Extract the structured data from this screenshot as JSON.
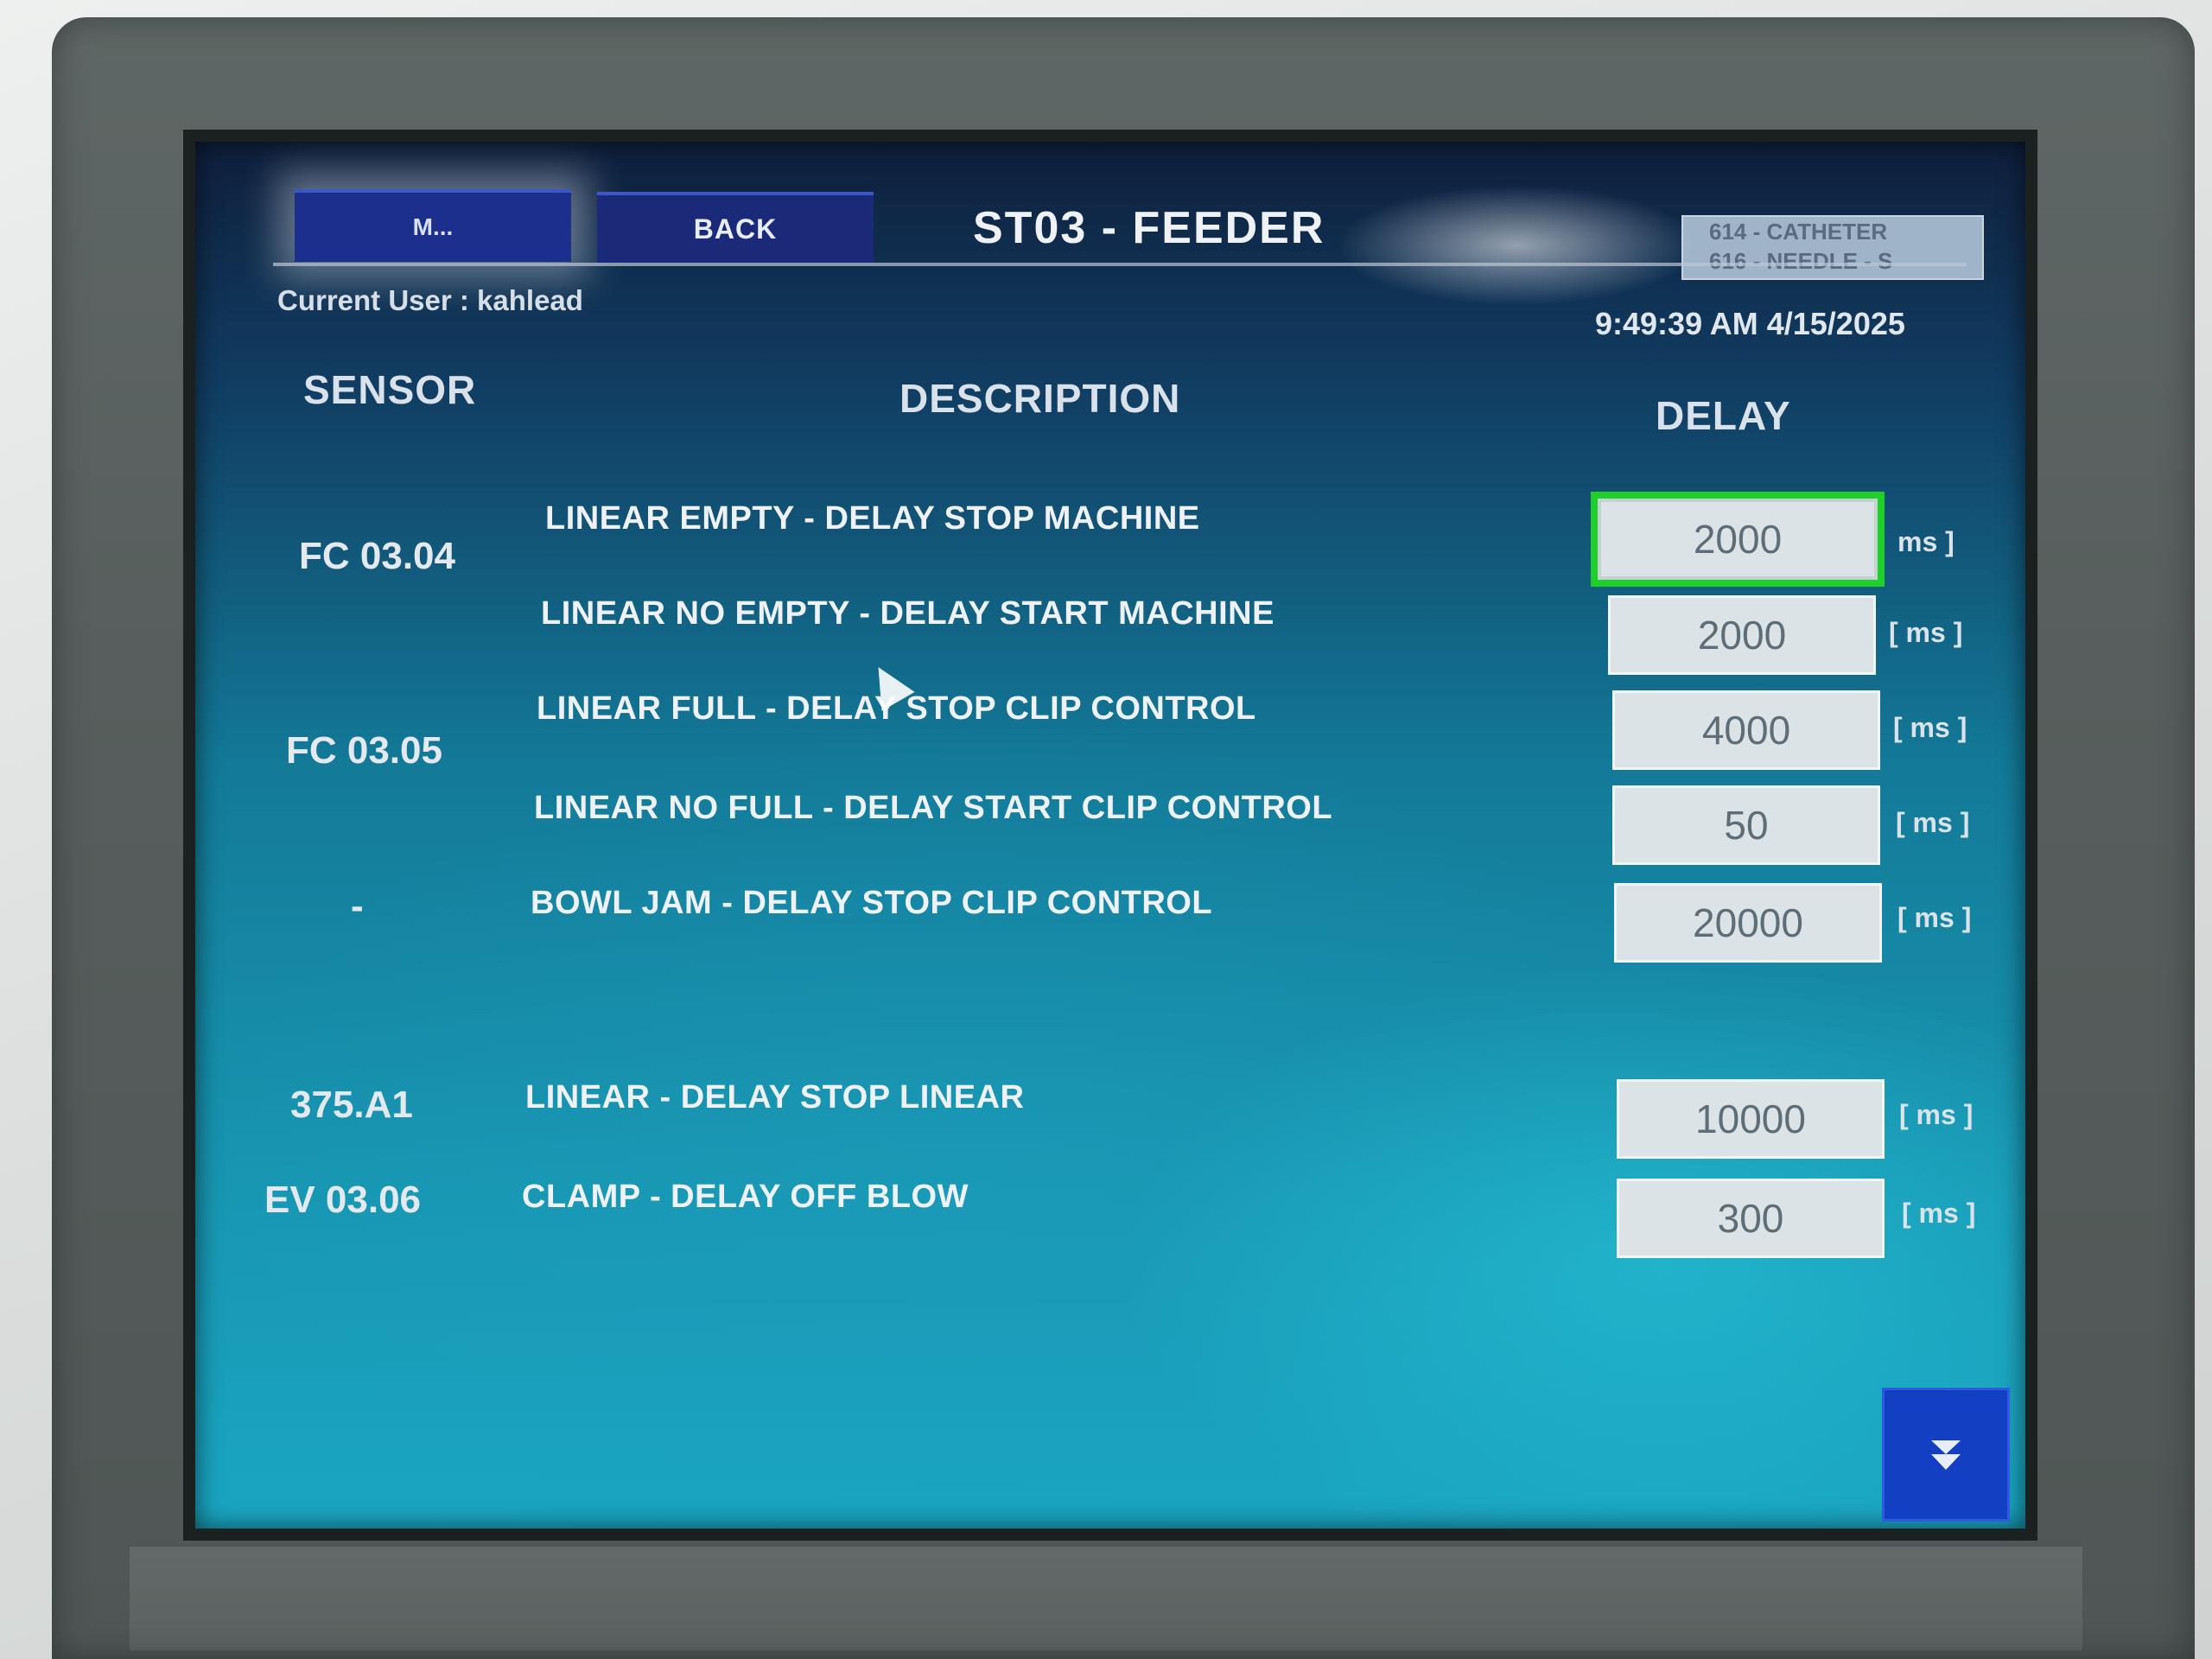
{
  "header": {
    "main_button_label": "M...",
    "back_button_label": "BACK",
    "title": "ST03 - FEEDER",
    "product_lines": [
      "614 - CATHETER",
      "616 - NEEDLE - S"
    ],
    "current_user": "Current User : kahlead",
    "datetime": "9:49:39 AM 4/15/2025"
  },
  "columns": {
    "sensor": "SENSOR",
    "description": "DESCRIPTION",
    "delay": "DELAY"
  },
  "sensors": [
    "FC 03.04",
    "FC 03.05",
    "-",
    "375.A1",
    "EV 03.06"
  ],
  "rows": [
    {
      "description": "LINEAR EMPTY - DELAY STOP MACHINE",
      "value": "2000",
      "unit": "ms ]"
    },
    {
      "description": "LINEAR NO EMPTY - DELAY START MACHINE",
      "value": "2000",
      "unit": "[ ms ]"
    },
    {
      "description": "LINEAR FULL - DELAY STOP CLIP CONTROL",
      "value": "4000",
      "unit": "[ ms ]"
    },
    {
      "description": "LINEAR NO FULL - DELAY START CLIP CONTROL",
      "value": "50",
      "unit": "[ ms ]"
    },
    {
      "description": "BOWL JAM - DELAY STOP CLIP CONTROL",
      "value": "20000",
      "unit": "[ ms ]"
    },
    {
      "description": "LINEAR - DELAY STOP LINEAR",
      "value": "10000",
      "unit": "[ ms ]"
    },
    {
      "description": "CLAMP - DELAY OFF BLOW",
      "value": "300",
      "unit": "[ ms ]"
    }
  ],
  "icons": {
    "down_button": "double-chevron-down-icon",
    "pointer": "mouse-pointer-icon"
  },
  "colors": {
    "focus_border": "#1fcf2a",
    "nav_button": "#1b2a78",
    "down_button": "#1340c2"
  }
}
